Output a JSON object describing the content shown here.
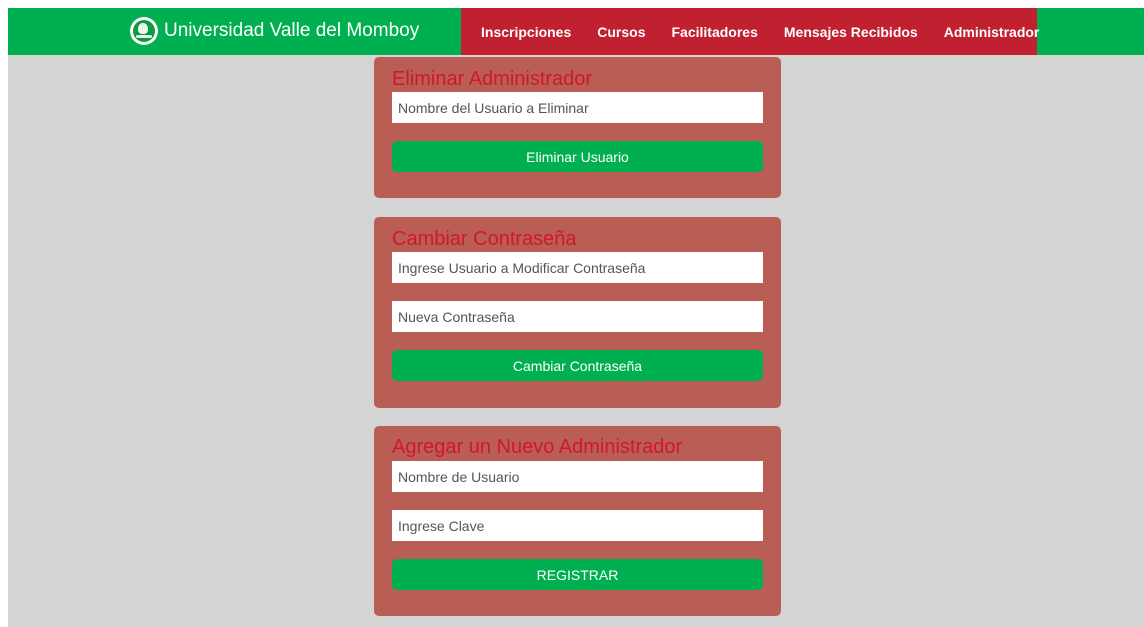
{
  "header": {
    "brand": "Universidad Valle del Momboy",
    "logo_icon": "university-logo-icon",
    "nav": [
      {
        "label": "Inscripciones"
      },
      {
        "label": "Cursos"
      },
      {
        "label": "Facilitadores"
      },
      {
        "label": "Mensajes Recibidos"
      },
      {
        "label": "Administrador"
      }
    ]
  },
  "delete_admin": {
    "title": "Eliminar Administrador",
    "username_placeholder": "Nombre del Usuario a Eliminar",
    "button": "Eliminar Usuario"
  },
  "change_password": {
    "title": "Cambiar Contraseña",
    "username_placeholder": "Ingrese Usuario a Modificar Contraseña",
    "new_password_placeholder": "Nueva Contraseña",
    "button": "Cambiar Contraseña"
  },
  "add_admin": {
    "title": "Agregar un Nuevo Administrador",
    "username_placeholder": "Nombre de Usuario",
    "password_placeholder": "Ingrese Clave",
    "button": "REGISTRAR"
  },
  "colors": {
    "navbar": "#00b050",
    "menu": "#c0202f",
    "panel": "#ba5e55",
    "title": "#d0182a",
    "button": "#00b050",
    "background": "#d5d4d5"
  }
}
